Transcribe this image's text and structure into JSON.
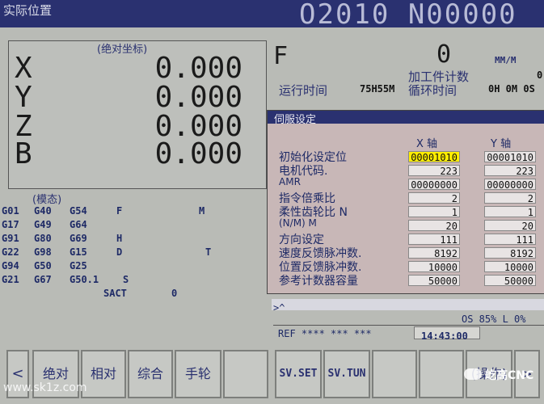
{
  "header": {
    "screen_title": "实际位置",
    "program_number": "O2010 N00000"
  },
  "position": {
    "title": "(绝对坐标)",
    "axes": [
      {
        "name": "X",
        "value": "0.000"
      },
      {
        "name": "Y",
        "value": "0.000"
      },
      {
        "name": "Z",
        "value": "0.000"
      },
      {
        "name": "B",
        "value": "0.000"
      }
    ]
  },
  "feed": {
    "label": "F",
    "value": "0",
    "unit": "MM/M"
  },
  "runtime": {
    "label": "运行时间",
    "value": "75H55M"
  },
  "parts": {
    "label": "加工件计数",
    "value": "0",
    "cycle_label": "循环时间",
    "cycle_value": "0H 0M 0S"
  },
  "modal": {
    "title": "(模态)",
    "rows": [
      [
        "G01",
        "G40",
        "G54",
        "F",
        "",
        "M"
      ],
      [
        "G17",
        "G49",
        "G64",
        "",
        "",
        ""
      ],
      [
        "G91",
        "G80",
        "G69",
        "H",
        "",
        ""
      ],
      [
        "G22",
        "G98",
        "G15",
        "D",
        "",
        "T"
      ],
      [
        "G94",
        "G50",
        "G25",
        "",
        "",
        ""
      ],
      [
        "G21",
        "G67",
        "G50.1",
        "S",
        "",
        ""
      ]
    ],
    "sact_label": "SACT",
    "sact_value": "0"
  },
  "servo": {
    "title": "伺服设定",
    "col_x": "X 轴",
    "col_y": "Y 轴",
    "params": [
      {
        "label": "初始化设定位",
        "x": "00001010",
        "y": "00001010"
      },
      {
        "label": "电机代码.",
        "x": "223",
        "y": "223"
      },
      {
        "label": "AMR",
        "x": "00000000",
        "y": "00000000"
      },
      {
        "label": "指令倍乘比",
        "x": "2",
        "y": "2"
      },
      {
        "label": "柔性齿轮比 N",
        "x": "1",
        "y": "1"
      },
      {
        "label": "(N/M) M",
        "x": "20",
        "y": "20"
      },
      {
        "label": "方向设定",
        "x": "111",
        "y": "111"
      },
      {
        "label": "速度反馈脉冲数.",
        "x": "8192",
        "y": "8192"
      },
      {
        "label": "位置反馈脉冲数.",
        "x": "10000",
        "y": "10000"
      },
      {
        "label": "参考计数器容量",
        "x": "50000",
        "y": "50000"
      }
    ]
  },
  "status": {
    "prompt": ">^",
    "os_line": "OS 85% L   0%",
    "ref_line": "REF **** *** ***",
    "clock": "14:43:00"
  },
  "softkeys": {
    "left": "<",
    "k1": "绝对",
    "k2": "相对",
    "k3": "综合",
    "k4": "手轮",
    "k5": "",
    "k6": "SV.SET",
    "k7": "SV.TUN",
    "k8": "",
    "k9": "",
    "k10": "(操作)",
    "right": ">"
  },
  "watermark": {
    "site": "www.sk1z.com",
    "brand": "屹高CNC"
  }
}
